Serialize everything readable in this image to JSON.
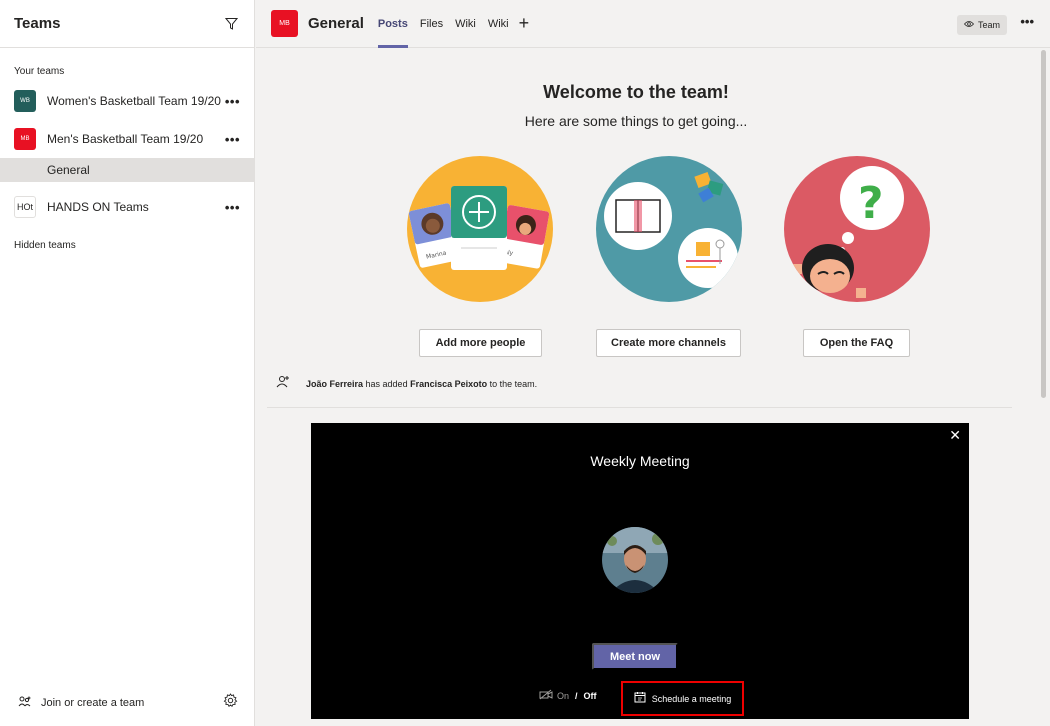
{
  "sidebar": {
    "title": "Teams",
    "your_teams_label": "Your teams",
    "teams": [
      {
        "initials": "WB",
        "name": "Women's Basketball Team 19/20",
        "color": "#235e5b"
      },
      {
        "initials": "MB",
        "name": "Men's Basketball Team 19/20",
        "color": "#e81123"
      },
      {
        "initials": "HOt",
        "name": "HANDS ON Teams",
        "color": "#ffffff"
      }
    ],
    "channels": [
      {
        "name": "General"
      }
    ],
    "more_label": "•••",
    "hidden_teams_label": "Hidden teams",
    "join_label": "Join or create a team"
  },
  "topbar": {
    "avatar_initials": "MB",
    "channel_name": "General",
    "tabs": [
      "Posts",
      "Files",
      "Wiki",
      "Wiki"
    ],
    "add_tab_label": "+",
    "team_button_label": "Team",
    "more_label": "•••"
  },
  "welcome": {
    "title": "Welcome to the team!",
    "subtitle": "Here are some things to get going...",
    "illustration_names": [
      "Marina",
      "Aly"
    ],
    "buttons": [
      "Add more people",
      "Create more channels",
      "Open the FAQ"
    ]
  },
  "activity": {
    "actor": "João Ferreira",
    "action": " has added ",
    "target": "Francisca Peixoto",
    "suffix": " to the team."
  },
  "meeting": {
    "close_label": "✕",
    "title": "Weekly Meeting",
    "meet_now_label": "Meet now",
    "camera_on_label": "On",
    "separator": "/",
    "camera_off_label": "Off",
    "schedule_label": "Schedule a meeting"
  },
  "colors": {
    "accent": "#6264a7",
    "highlight_border": "#ee0000"
  }
}
